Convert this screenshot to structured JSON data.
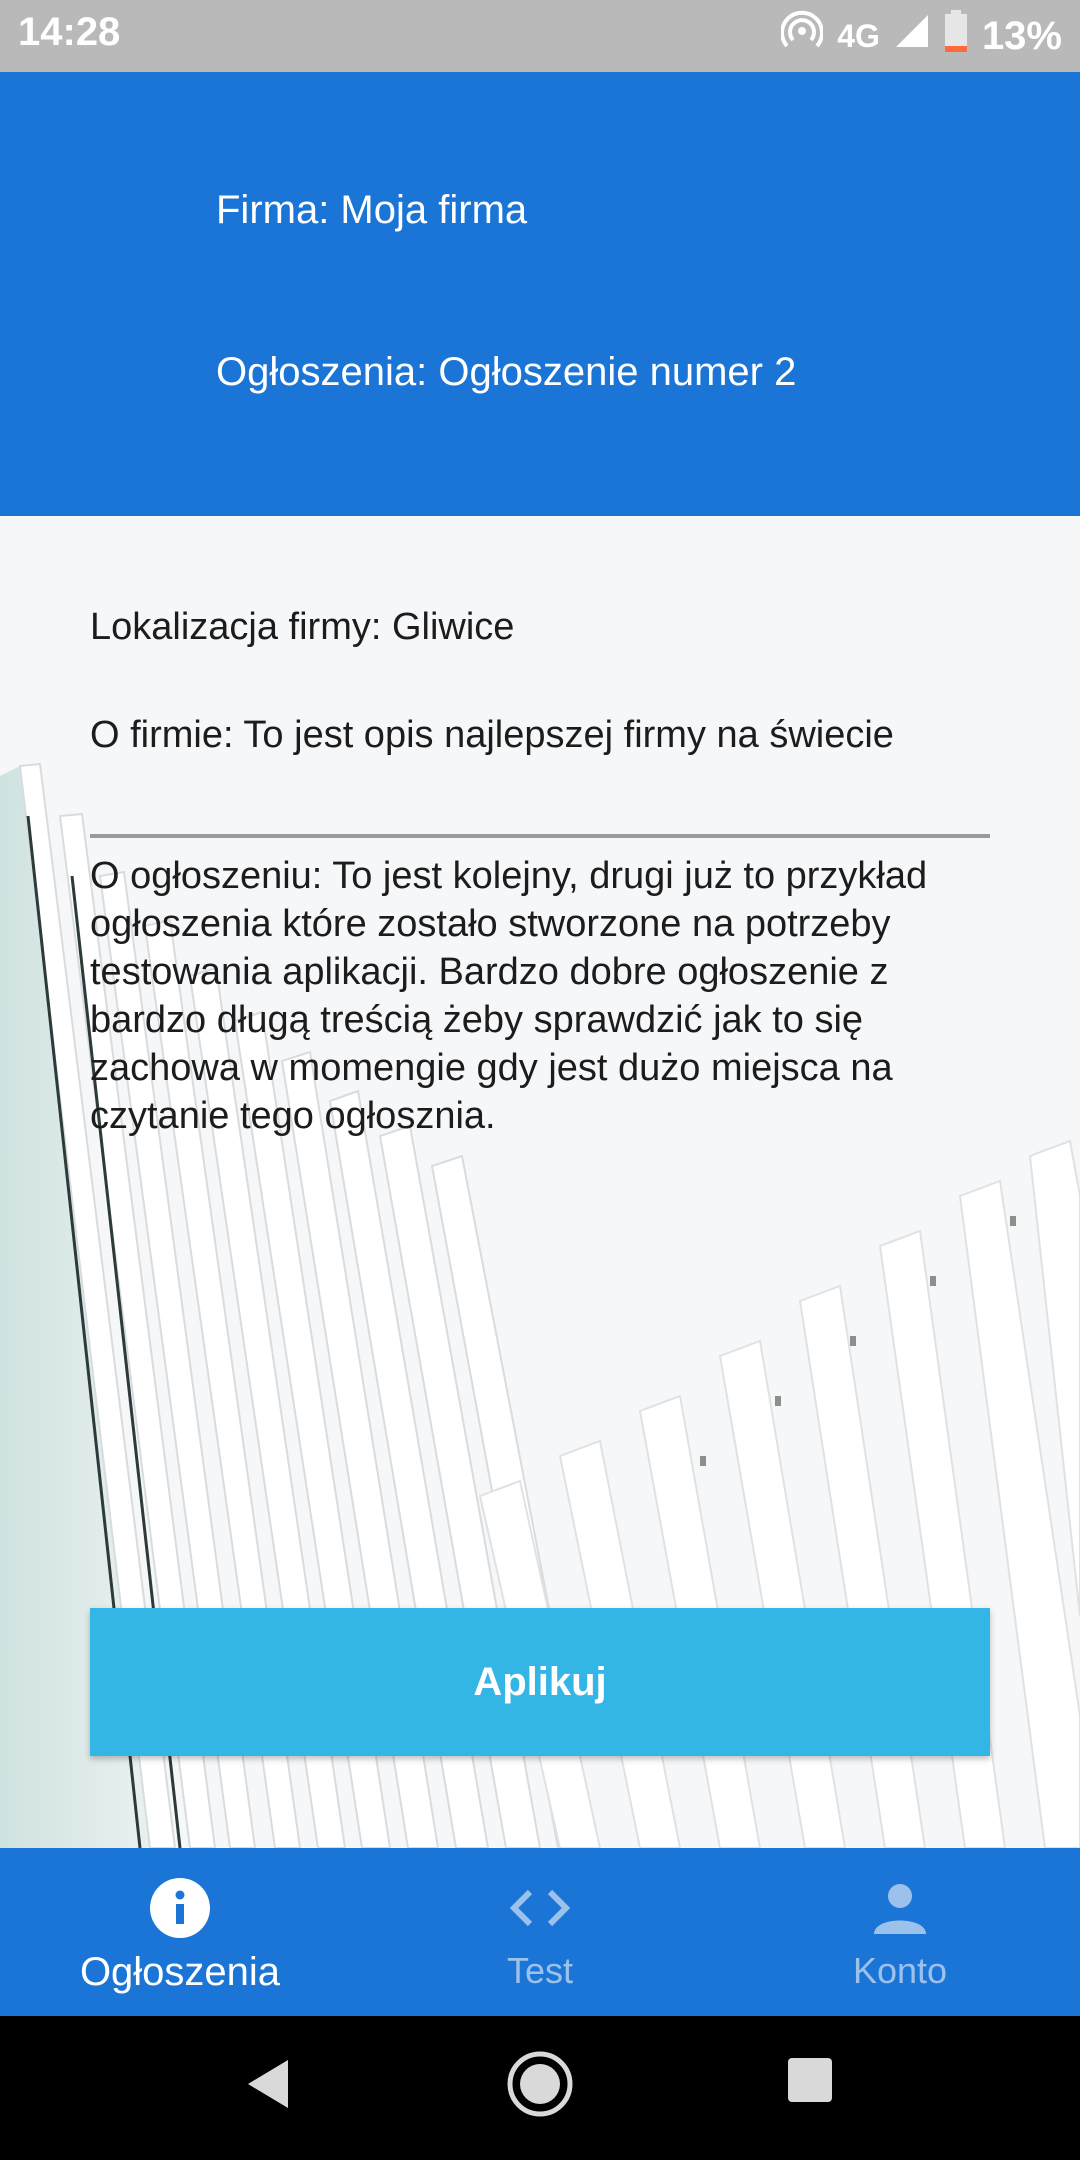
{
  "status_bar": {
    "time": "14:28",
    "network": "4G",
    "battery": "13%"
  },
  "header": {
    "company": "Firma: Moja firma",
    "ad": "Ogłoszenia: Ogłoszenie numer 2"
  },
  "details": {
    "location": "Lokalizacja firmy: Gliwice",
    "about": "O firmie: To jest opis najlepszej firmy na świecie",
    "ad_description": "O ogłoszeniu: To jest kolejny, drugi już to przykład ogłoszenia które zostało stworzone na potrzeby testowania aplikacji. Bardzo dobre ogłoszenie z bardzo długą treścią żeby sprawdzić jak to się zachowa w momengie gdy jest dużo miejsca na czytanie tego ogłosznia."
  },
  "apply_label": "Aplikuj",
  "bottom_nav": [
    {
      "label": "Ogłoszenia",
      "icon": "info-icon",
      "active": true
    },
    {
      "label": "Test",
      "icon": "code-icon",
      "active": false
    },
    {
      "label": "Konto",
      "icon": "person-icon",
      "active": false
    }
  ],
  "colors": {
    "primary": "#1b75d6",
    "button": "#33b5e5",
    "status_bar": "#b9b9b9"
  }
}
